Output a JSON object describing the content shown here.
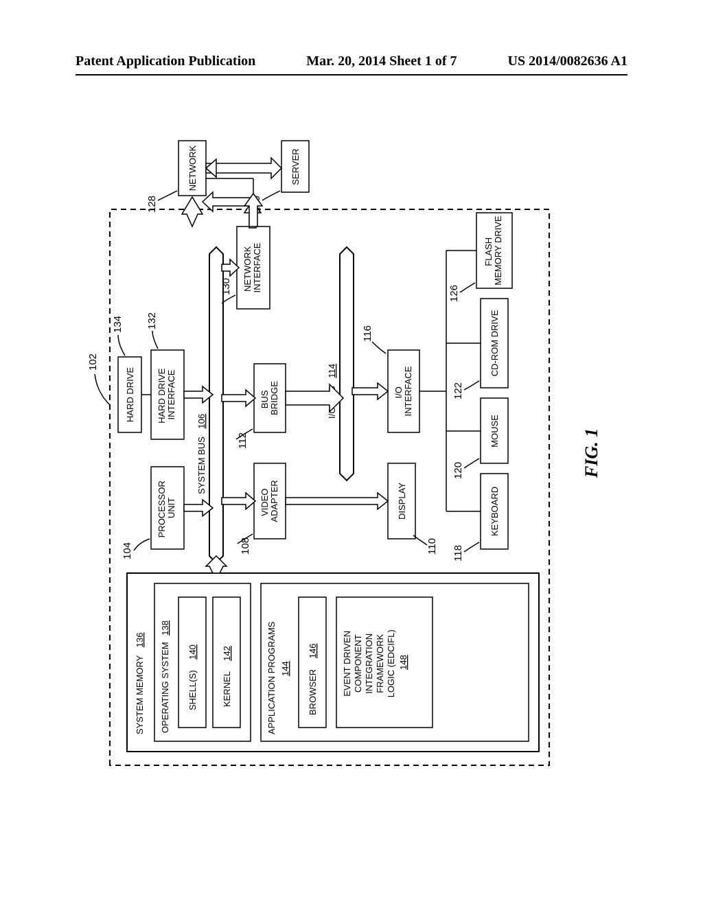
{
  "header": {
    "left": "Patent Application Publication",
    "center": "Mar. 20, 2014  Sheet 1 of 7",
    "right": "US 2014/0082636 A1"
  },
  "figure_label": "FIG. 1",
  "refs": {
    "computer": "102",
    "processor": "104",
    "system_bus": "106",
    "video_adapter": "108",
    "display": "110",
    "bus_bridge": "112",
    "io_bus": "114",
    "io_interface": "116",
    "keyboard": "118",
    "mouse": "120",
    "cdrom": "122",
    "flash": "126",
    "network": "128",
    "network_if": "130",
    "hd_if": "132",
    "hard_drive": "134",
    "sysmem": "136",
    "os": "138",
    "shell": "140",
    "kernel": "142",
    "apps": "144",
    "browser": "146",
    "edcifl": "148",
    "server": "150"
  },
  "labels": {
    "processor": "PROCESSOR\nUNIT",
    "system_bus": "SYSTEM BUS",
    "video_adapter": "VIDEO\nADAPTER",
    "display": "DISPLAY",
    "bus_bridge": "BUS\nBRIDGE",
    "io_bus": "I/O BUS",
    "io_interface": "I/O\nINTERFACE",
    "keyboard": "KEYBOARD",
    "mouse": "MOUSE",
    "cdrom": "CD-ROM DRIVE",
    "flash": "FLASH\nMEMORY DRIVE",
    "network": "NETWORK",
    "network_if": "NETWORK\nINTERFACE",
    "hd_if": "HARD DRIVE\nINTERFACE",
    "hard_drive": "HARD DRIVE",
    "sysmem": "SYSTEM MEMORY",
    "os": "OPERATING SYSTEM",
    "shell": "SHELL(S)",
    "kernel": "KERNEL",
    "apps": "APPLICATION PROGRAMS",
    "browser": "BROWSER",
    "edcifl": "EVENT DRIVEN\nCOMPONENT\nINTEGRATION\nFRAMEWORK\nLOGIC (EDCIFL)",
    "server": "SERVER"
  }
}
